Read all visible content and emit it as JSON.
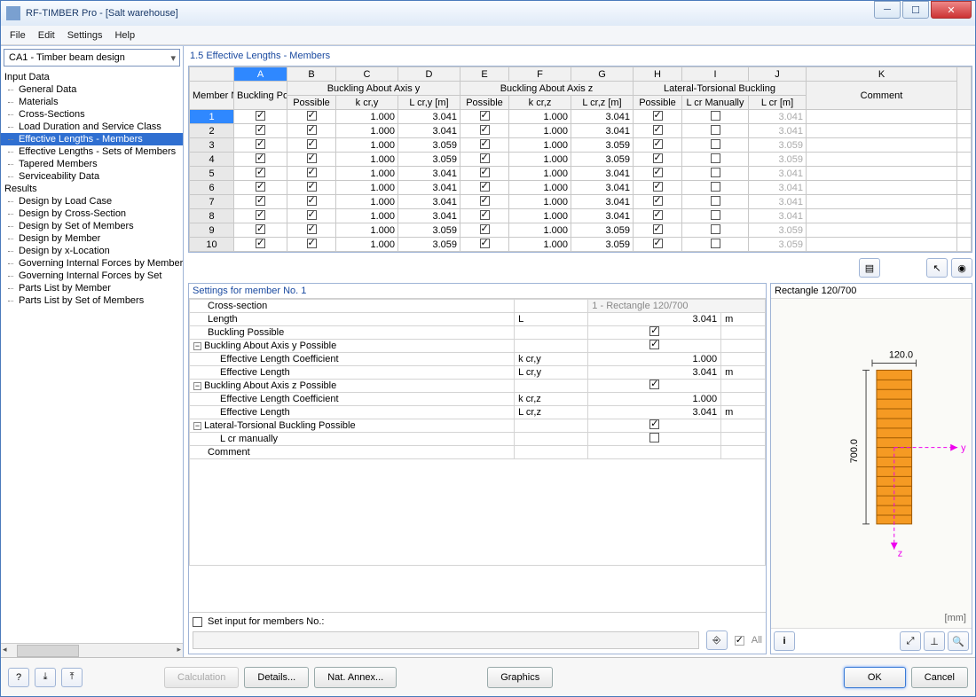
{
  "window": {
    "title": "RF-TIMBER Pro - [Salt warehouse]"
  },
  "menu": {
    "file": "File",
    "edit": "Edit",
    "settings": "Settings",
    "help": "Help"
  },
  "module": {
    "selected": "CA1 - Timber beam design"
  },
  "tree": {
    "input_header": "Input Data",
    "input_items": [
      "General Data",
      "Materials",
      "Cross-Sections",
      "Load Duration and Service Class",
      "Effective Lengths - Members",
      "Effective Lengths - Sets of Members",
      "Tapered Members",
      "Serviceability Data"
    ],
    "selected_index": 4,
    "results_header": "Results",
    "results_items": [
      "Design by Load Case",
      "Design by Cross-Section",
      "Design by Set of Members",
      "Design by Member",
      "Design by x-Location",
      "Governing Internal Forces by Member",
      "Governing Internal Forces by Set",
      "Parts List by Member",
      "Parts List by Set of Members"
    ]
  },
  "pane": {
    "title": "1.5 Effective Lengths - Members"
  },
  "grid": {
    "letters": [
      "A",
      "B",
      "C",
      "D",
      "E",
      "F",
      "G",
      "H",
      "I",
      "J",
      "K"
    ],
    "group1": "Buckling About Axis y",
    "group2": "Buckling About Axis z",
    "group3": "Lateral-Torsional Buckling",
    "h_member": "Member No.",
    "h_buckling": "Buckling Possible",
    "h_possible": "Possible",
    "h_kcry": "k cr,y",
    "h_lcry": "L cr,y [m]",
    "h_kcrz": "k cr,z",
    "h_lcrz": "L cr,z [m]",
    "h_lcrman": "L cr Manually",
    "h_lcr": "L cr [m]",
    "h_comment": "Comment",
    "rows": [
      {
        "no": "1",
        "bk": true,
        "py": true,
        "kcry": "1.000",
        "lcry": "3.041",
        "pz": true,
        "kcrz": "1.000",
        "lcrz": "3.041",
        "plt": true,
        "man": false,
        "lcr": "3.041",
        "c": ""
      },
      {
        "no": "2",
        "bk": true,
        "py": true,
        "kcry": "1.000",
        "lcry": "3.041",
        "pz": true,
        "kcrz": "1.000",
        "lcrz": "3.041",
        "plt": true,
        "man": false,
        "lcr": "3.041",
        "c": ""
      },
      {
        "no": "3",
        "bk": true,
        "py": true,
        "kcry": "1.000",
        "lcry": "3.059",
        "pz": true,
        "kcrz": "1.000",
        "lcrz": "3.059",
        "plt": true,
        "man": false,
        "lcr": "3.059",
        "c": ""
      },
      {
        "no": "4",
        "bk": true,
        "py": true,
        "kcry": "1.000",
        "lcry": "3.059",
        "pz": true,
        "kcrz": "1.000",
        "lcrz": "3.059",
        "plt": true,
        "man": false,
        "lcr": "3.059",
        "c": ""
      },
      {
        "no": "5",
        "bk": true,
        "py": true,
        "kcry": "1.000",
        "lcry": "3.041",
        "pz": true,
        "kcrz": "1.000",
        "lcrz": "3.041",
        "plt": true,
        "man": false,
        "lcr": "3.041",
        "c": ""
      },
      {
        "no": "6",
        "bk": true,
        "py": true,
        "kcry": "1.000",
        "lcry": "3.041",
        "pz": true,
        "kcrz": "1.000",
        "lcrz": "3.041",
        "plt": true,
        "man": false,
        "lcr": "3.041",
        "c": ""
      },
      {
        "no": "7",
        "bk": true,
        "py": true,
        "kcry": "1.000",
        "lcry": "3.041",
        "pz": true,
        "kcrz": "1.000",
        "lcrz": "3.041",
        "plt": true,
        "man": false,
        "lcr": "3.041",
        "c": ""
      },
      {
        "no": "8",
        "bk": true,
        "py": true,
        "kcry": "1.000",
        "lcry": "3.041",
        "pz": true,
        "kcrz": "1.000",
        "lcrz": "3.041",
        "plt": true,
        "man": false,
        "lcr": "3.041",
        "c": ""
      },
      {
        "no": "9",
        "bk": true,
        "py": true,
        "kcry": "1.000",
        "lcry": "3.059",
        "pz": true,
        "kcrz": "1.000",
        "lcrz": "3.059",
        "plt": true,
        "man": false,
        "lcr": "3.059",
        "c": ""
      },
      {
        "no": "10",
        "bk": true,
        "py": true,
        "kcry": "1.000",
        "lcry": "3.059",
        "pz": true,
        "kcrz": "1.000",
        "lcrz": "3.059",
        "plt": true,
        "man": false,
        "lcr": "3.059",
        "c": ""
      }
    ]
  },
  "settings": {
    "title": "Settings for member No. 1",
    "rows": {
      "cross_section": "Cross-section",
      "cross_section_val": "1 - Rectangle 120/700",
      "length": "Length",
      "length_sym": "L",
      "length_val": "3.041",
      "length_unit": "m",
      "buckling_possible": "Buckling Possible",
      "buck_y": "Buckling About Axis y Possible",
      "eff_len_coef": "Effective Length Coefficient",
      "eff_len": "Effective Length",
      "kcry_sym": "k cr,y",
      "kcry_val": "1.000",
      "lcry_sym": "L cr,y",
      "lcry_val": "3.041",
      "lcry_unit": "m",
      "buck_z": "Buckling About Axis z Possible",
      "kcrz_sym": "k cr,z",
      "kcrz_val": "1.000",
      "lcrz_sym": "L cr,z",
      "lcrz_val": "3.041",
      "lcrz_unit": "m",
      "lat_tor": "Lateral-Torsional Buckling Possible",
      "lcr_man": "L cr manually",
      "comment": "Comment"
    },
    "setinput_label": "Set input for members No.:",
    "all_label": "All"
  },
  "preview": {
    "title": "Rectangle 120/700",
    "width": "120.0",
    "height": "700.0",
    "unit": "[mm]",
    "axis_y": "y",
    "axis_z": "z"
  },
  "footer": {
    "calculation": "Calculation",
    "details": "Details...",
    "nat_annex": "Nat. Annex...",
    "graphics": "Graphics",
    "ok": "OK",
    "cancel": "Cancel"
  }
}
